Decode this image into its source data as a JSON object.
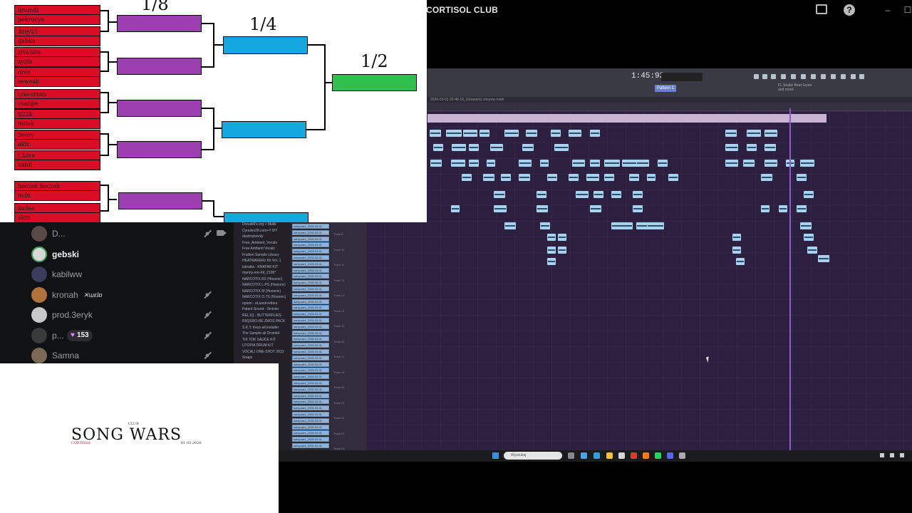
{
  "topbar": {
    "server_title": "CORTISOL CLUB",
    "inbox_icon": "inbox-icon",
    "help_icon": "?",
    "minimize_icon": "–",
    "maximize_icon": "☐"
  },
  "bracket": {
    "round_labels": {
      "r8": "1/8",
      "r4": "1/4",
      "r2": "1/2"
    },
    "players": [
      "bromdi",
      "pekrocyn",
      "dzey21",
      "gabka",
      "zivahirs",
      "zyzia",
      "orex",
      "seweak",
      "cracerson",
      "csanpe",
      "tj22k",
      "mitek",
      "3eery",
      "akiz",
      "j.3ove",
      "kabil",
      "boczek boczek",
      "mdn",
      "kades",
      "skzz"
    ],
    "colors": {
      "first_round": "#d90d26",
      "r8": "#9b3fb1",
      "r4": "#14a8df",
      "r2": "#2fc04e"
    }
  },
  "voice": {
    "members": [
      {
        "name": "D...",
        "muted": true,
        "camera": true
      },
      {
        "name": "gebski",
        "active": true
      },
      {
        "name": "kabilww"
      },
      {
        "name": "kronah",
        "tag": "✕ɯɛʇɒ",
        "muted": true
      },
      {
        "name": "prod.3eryk",
        "muted": true
      },
      {
        "name": "p...",
        "badge_count": "153",
        "muted": true
      },
      {
        "name": "Samna",
        "muted": true
      }
    ]
  },
  "songwars": {
    "club": "CLUB",
    "title": "SONG WARS",
    "brand": "CORTISOL",
    "date": "01.03.2026"
  },
  "fl": {
    "time": "1:45:92",
    "pattern_label": "Pattern 1",
    "hint_line1": "FL Studio Beat Score",
    "hint_line2": "and more!",
    "path": "2026-03-01 20-46-19_(Ghanam) cmurow main",
    "browser_items": [
      "Donalidi's.org + Malki",
      "Cynules28.com+Y 8/Y",
      "destroyloonly",
      "Free_Ambient_Vocals",
      "Free Ambient Vocals",
      "Fruition Sample Library",
      "HEATMAKERz Kit Vol. 1",
      "lukratiw - KRATAR KIT",
      "manny-ore-Kit_2105*",
      "NARCOTIX R2 (Hosonic)",
      "NARCOTIX L.PS (Hosonic)",
      "NARCOTIX M (Hosonic)",
      "NARCOTIX O.7S (Hosonic)",
      "opium - at.unstrovibes",
      "Patent Sound - Sinister",
      "REL1Q - BUTTERFLIES",
      "RI/QSRO-RE.ZMOS PACK",
      "S.K.Y. Keys-all.installer",
      "The Sample all Drumkit",
      "TIK TOK SAUCE KIT",
      "UTOPIA DRUM KIT",
      "VOCALI ONE-SHOT 2023",
      "Snaps"
    ],
    "clip_name": "sampuani_2026-03-01",
    "tracks": [
      "Track 9",
      "Track 10",
      "Track 11",
      "Track 12",
      "Track 13",
      "Track 14",
      "Track 15",
      "Track 16",
      "Track 17",
      "Track 18",
      "Track 19",
      "Track 20",
      "Track 21",
      "Track 22",
      "Track 23",
      "Track 24"
    ]
  },
  "taskbar": {
    "search_placeholder": "Wyszukaj"
  }
}
